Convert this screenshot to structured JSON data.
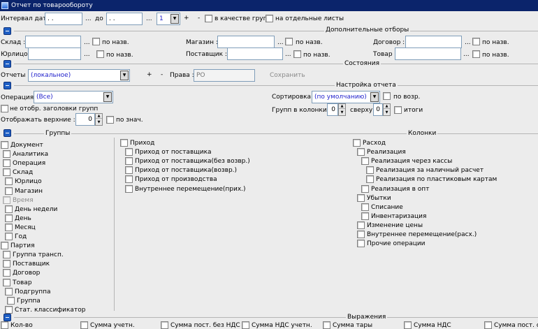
{
  "window": {
    "title": "Отчет по товарообороту"
  },
  "period": {
    "label": "Интервал дат :",
    "from_value": " .  .",
    "from_ellipsis": "...",
    "to_label": "до",
    "to_value": " .  .",
    "to_ellipsis": "...",
    "count_value": "1",
    "plus": "+",
    "minus": "-",
    "as_groups_label": "в качестве групп",
    "separate_sheets_label": "на отдельные листы"
  },
  "filters": {
    "section_title": "Дополнительные отборы",
    "by_name": "по назв.",
    "ellipsis": "...",
    "warehouse_label": "Склад :",
    "store_label": "Магазин :",
    "contract_label": "Договор :",
    "legal_entity_label": "Юрлицо :",
    "supplier_label": "Поставщик :",
    "product_label": "Товар :"
  },
  "states": {
    "section_title": "Состояния",
    "reports_label": "Отчеты :",
    "reports_value": "(локальное)",
    "plus": "+",
    "minus": "-",
    "rights_label": "Права :",
    "rights_value": "РО",
    "save_label": "Сохранить"
  },
  "settings": {
    "section_title": "Настройка отчета",
    "operation_label": "Операция :",
    "operation_value": "(Все)",
    "no_group_headers_label": "не отобр. заголовки групп",
    "show_top_label": "Отображать верхние :",
    "show_top_value": "0",
    "by_value_label": "по знач.",
    "sort_label": "Сортировка :",
    "sort_value": "(по умолчанию)",
    "ascending_label": "по возр.",
    "groups_in_columns_label": "Групп в колонки :",
    "groups_in_columns_value": "0",
    "top_label": "сверху",
    "top_value": "0",
    "totals_label": "итоги"
  },
  "groups_section": {
    "title": "Группы",
    "columns_title": "Колонки"
  },
  "groups": [
    "Документ",
    "Аналитика",
    "Операция",
    "Склад",
    "Юрлицо",
    "Магазин",
    "Время",
    "День недели",
    "День",
    "Месяц",
    "Год",
    "Партия",
    "Группа трансп.",
    "Поставщик",
    "Договор",
    "Товар",
    "Подгруппа",
    "Группа",
    "Стат. классификатор"
  ],
  "income": [
    "Приход",
    "Приход от поставщика",
    "Приход от поставщика(без возвр.)",
    "Приход от поставщика(возвр.)",
    "Приход от производства",
    "Внутреннее перемещение(прих.)"
  ],
  "expense": [
    "Расход",
    "Реализация",
    "Реализация через кассы",
    "Реализация за наличный расчет",
    "Реализация по пластиковым картам",
    "Реализация в опт",
    "Убытки",
    "Списание",
    "Инвентаризация",
    "Изменение цены",
    "Внутреннее перемещение(расх.)",
    "Прочие операции"
  ],
  "expressions": {
    "section_title": "Выражения",
    "items": [
      "Кол-во",
      "Сумма учетн.",
      "Сумма пост. без НДС",
      "Сумма НДС учетн.",
      "Сумма тары",
      "Сумма НДС",
      "Сумма пост. с НДС"
    ]
  }
}
